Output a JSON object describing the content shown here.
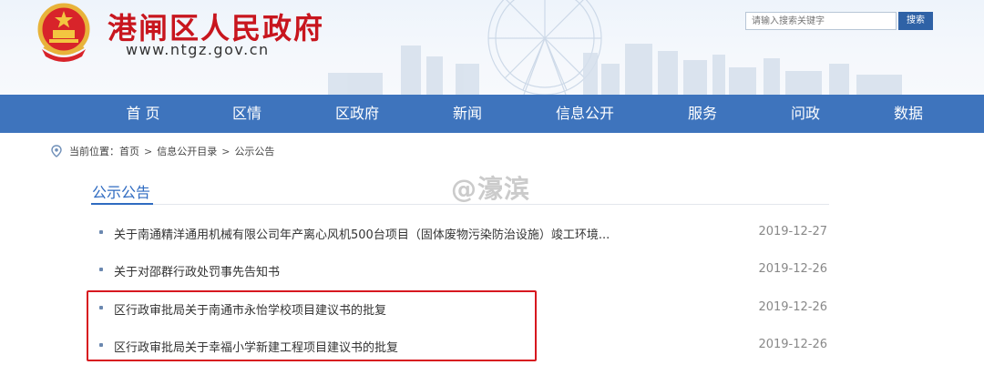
{
  "header": {
    "site_title": "港闸区人民政府",
    "site_url": "www.ntgz.gov.cn",
    "search_placeholder": "请输入搜索关键字",
    "search_button": "搜索"
  },
  "nav": {
    "items": [
      "首 页",
      "区情",
      "区政府",
      "新闻",
      "信息公开",
      "服务",
      "问政",
      "数据"
    ]
  },
  "breadcrumb": {
    "prefix": "当前位置：",
    "items": [
      "首页",
      "信息公开目录",
      "公示公告"
    ],
    "separator": ">"
  },
  "section": {
    "title": "公示公告"
  },
  "watermark": "@濠滨",
  "list": [
    {
      "title": "关于南通精洋通用机械有限公司年产离心风机500台项目（固体废物污染防治设施）竣工环境...",
      "date": "2019-12-27"
    },
    {
      "title": "关于对邵群行政处罚事先告知书",
      "date": "2019-12-26"
    },
    {
      "title": "区行政审批局关于南通市永怡学校项目建议书的批复",
      "date": "2019-12-26"
    },
    {
      "title": "区行政审批局关于幸福小学新建工程项目建议书的批复",
      "date": "2019-12-26"
    }
  ],
  "colors": {
    "title_red": "#c8161e",
    "nav_blue": "#3e74bd",
    "section_blue": "#2f6bc1",
    "highlight_red": "#d7181f"
  }
}
